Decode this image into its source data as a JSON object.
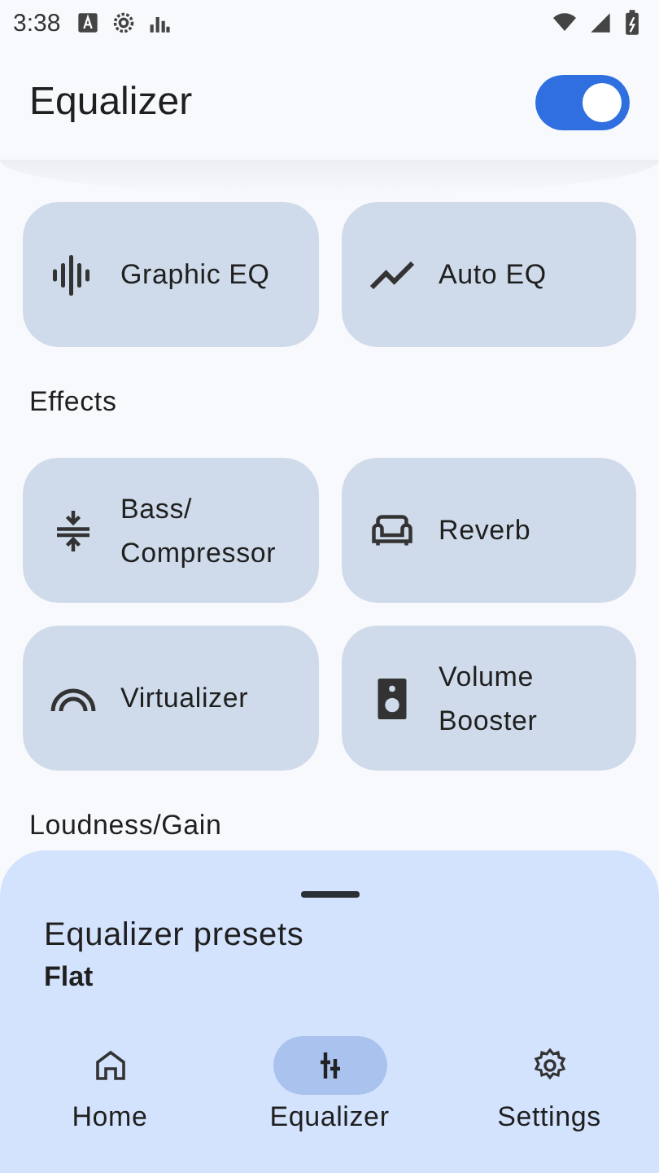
{
  "status_bar": {
    "time": "3:38"
  },
  "header": {
    "title": "Equalizer",
    "enabled": true
  },
  "eq_tiles": [
    {
      "label": "Graphic EQ"
    },
    {
      "label": "Auto EQ"
    }
  ],
  "effects": {
    "title": "Effects",
    "tiles": [
      {
        "label": "Bass/\nCompressor"
      },
      {
        "label": "Reverb"
      },
      {
        "label": "Virtualizer"
      },
      {
        "label": "Volume\nBooster"
      }
    ]
  },
  "loudness": {
    "title": "Loudness/Gain"
  },
  "sheet": {
    "title": "Equalizer presets",
    "value": "Flat"
  },
  "nav": [
    {
      "label": "Home",
      "selected": false
    },
    {
      "label": "Equalizer",
      "selected": true
    },
    {
      "label": "Settings",
      "selected": false
    }
  ]
}
